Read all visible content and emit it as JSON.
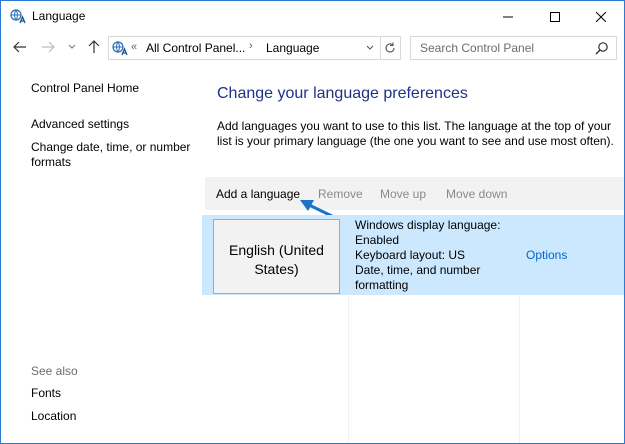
{
  "window": {
    "title": "Language",
    "icon": "language-icon",
    "controls": [
      "minimize-icon",
      "maximize-icon",
      "close-icon"
    ]
  },
  "address_bar": {
    "overflow": "«",
    "crumbs": [
      "All Control Panel...",
      "Language"
    ],
    "separator": "›"
  },
  "search": {
    "placeholder": "Search Control Panel"
  },
  "sidebar": {
    "home": "Control Panel Home",
    "advanced": "Advanced settings",
    "datetime": "Change date, time, or number formats",
    "see_also_heading": "See also",
    "see_also": [
      "Fonts",
      "Location"
    ]
  },
  "main": {
    "heading": "Change your language preferences",
    "description": "Add languages you want to use to this list. The language at the top of your list is your primary language (the one you want to see and use most often).",
    "toolbar": {
      "add": "Add a language",
      "remove": "Remove",
      "move_up": "Move up",
      "move_down": "Move down"
    },
    "languages": [
      {
        "name_line1": "English (United",
        "name_line2": "States)",
        "info": [
          "Windows display language:",
          "Enabled",
          "Keyboard layout: US",
          "Date, time, and number",
          "formatting"
        ],
        "options": "Options"
      }
    ]
  },
  "colors": {
    "accent_link": "#1e3287",
    "selected_row": "#cce8ff",
    "options_link": "#0066cc",
    "arrow": "#1a73c8"
  }
}
